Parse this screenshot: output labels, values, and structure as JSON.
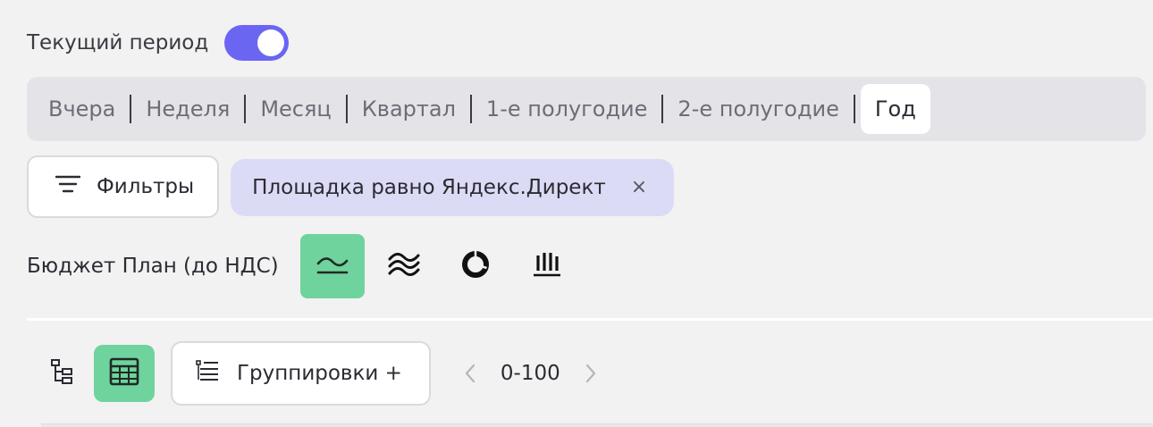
{
  "period": {
    "label": "Текущий период",
    "toggle_on": true
  },
  "segments": [
    {
      "label": "Вчера",
      "active": false
    },
    {
      "label": "Неделя",
      "active": false
    },
    {
      "label": "Месяц",
      "active": false
    },
    {
      "label": "Квартал",
      "active": false
    },
    {
      "label": "1-е полугодие",
      "active": false
    },
    {
      "label": "2-е полугодие",
      "active": false
    },
    {
      "label": "Год",
      "active": true
    }
  ],
  "filters": {
    "button_label": "Фильтры",
    "chip_label": "Площадка равно Яндекс.Директ",
    "chip_close": "×"
  },
  "metric": {
    "label": "Бюджет План (до НДС)",
    "chart_types": [
      "area-line-icon",
      "multi-wave-icon",
      "donut-icon",
      "bar-chart-icon"
    ],
    "active_chart": "area-line-icon"
  },
  "toolbar": {
    "tree_icon": "tree-view-icon",
    "table_icon": "table-view-icon",
    "group_label": "Группировки +",
    "pager_text": "0-100"
  },
  "colors": {
    "accent": "#6a66f2",
    "green": "#6fd39e",
    "chip_bg": "#dcdbf5",
    "segment_bg": "#e4e4e8"
  }
}
